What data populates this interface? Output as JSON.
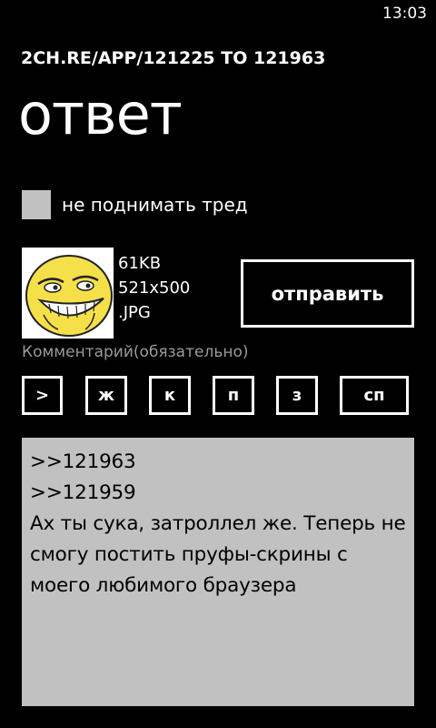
{
  "status_bar": {
    "time": "13:03"
  },
  "header": {
    "app_title": "2CH.RE/APP/121225 TO 121963",
    "page_title": "ответ"
  },
  "options": {
    "no_bump_label": "не поднимать тред",
    "no_bump_checked": false
  },
  "attachment": {
    "size": "61KB",
    "dimensions": "521x500",
    "extension": ".JPG",
    "thumbnail_icon": "trollface-thumbnail"
  },
  "actions": {
    "send_label": "отправить"
  },
  "comment": {
    "label": "Комментарий(обязательно)",
    "lines": [
      ">>121963",
      ">>121959",
      "Ах ты сука, затроллел же. Теперь не",
      "смогу постить пруфы-скрины с",
      "моего любимого браузера"
    ]
  },
  "format_buttons": [
    {
      "label": ">"
    },
    {
      "label": "ж"
    },
    {
      "label": "к"
    },
    {
      "label": "п"
    },
    {
      "label": "з"
    },
    {
      "label": "сп"
    }
  ],
  "colors": {
    "background": "#000000",
    "foreground": "#ffffff",
    "input_gray": "#c1c1c1",
    "hint_gray": "#9a9a9a",
    "face_yellow": "#f6e04a"
  }
}
